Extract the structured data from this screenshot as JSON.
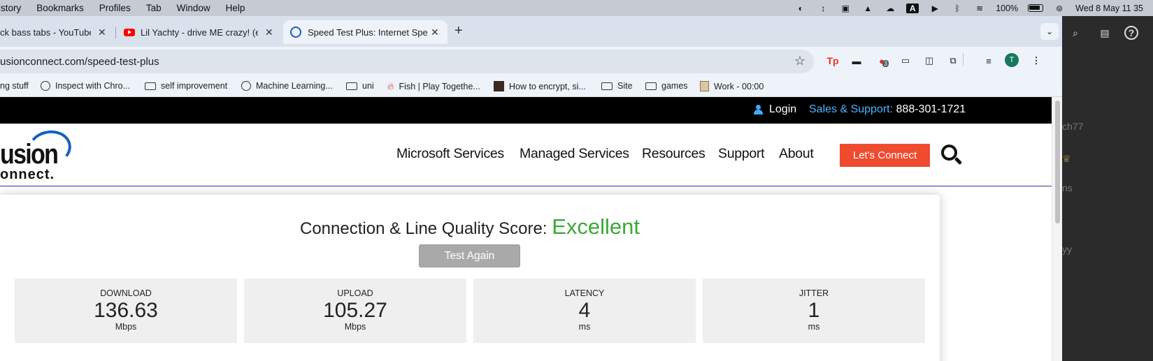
{
  "menubar": {
    "menus": [
      "istory",
      "Bookmarks",
      "Profiles",
      "Tab",
      "Window",
      "Help"
    ],
    "battery": "100%",
    "datetime": "Wed 8 May  11 35"
  },
  "tabs": [
    {
      "title": "ck bass tabs - YouTube",
      "favicon": "none"
    },
    {
      "title": "Lil Yachty - drive ME crazy! (e",
      "favicon": "youtube-icon"
    },
    {
      "title": "Speed Test Plus: Internet Spe",
      "favicon": "speedtest-icon",
      "active": true
    }
  ],
  "toolbar": {
    "url": "usionconnect.com/speed-test-plus",
    "profile_initial": "T",
    "ext_badge": "3"
  },
  "bookmarks": [
    {
      "label": "ng stuff",
      "icon": "none"
    },
    {
      "label": "Inspect with Chro...",
      "icon": "globe"
    },
    {
      "label": "self improvement",
      "icon": "folder"
    },
    {
      "label": "Machine Learning...",
      "icon": "globe"
    },
    {
      "label": "uni",
      "icon": "folder"
    },
    {
      "label": "Fish | Play Togethe...",
      "icon": "flame"
    },
    {
      "label": "How to encrypt, si...",
      "icon": "image"
    },
    {
      "label": "Site",
      "icon": "folder"
    },
    {
      "label": "games",
      "icon": "folder"
    },
    {
      "label": "Work - 00:00",
      "icon": "work"
    }
  ],
  "site": {
    "topbar": {
      "login": "Login",
      "sales_label": "Sales & Support:",
      "phone": "888-301-1721"
    },
    "logo": {
      "line1": "usion",
      "line2": "onnect."
    },
    "nav": [
      "Microsoft Services",
      "Managed Services",
      "Resources",
      "Support",
      "About"
    ],
    "cta": "Let's Connect"
  },
  "speedtest": {
    "score_label": "Connection & Line Quality Score:",
    "score_value": "Excellent",
    "test_again": "Test Again",
    "metrics": [
      {
        "label": "DOWNLOAD",
        "value": "136.63",
        "unit": "Mbps"
      },
      {
        "label": "UPLOAD",
        "value": "105.27",
        "unit": "Mbps"
      },
      {
        "label": "LATENCY",
        "value": "4",
        "unit": "ms"
      },
      {
        "label": "JITTER",
        "value": "1",
        "unit": "ms"
      }
    ]
  },
  "sidepanel": {
    "fragments": [
      "ch77",
      "ns",
      "yy"
    ]
  },
  "colors": {
    "accent_cta": "#ef4b2f",
    "excellent": "#3aa935",
    "support_blue": "#4db4ff",
    "logo_blue": "#1560bd"
  }
}
